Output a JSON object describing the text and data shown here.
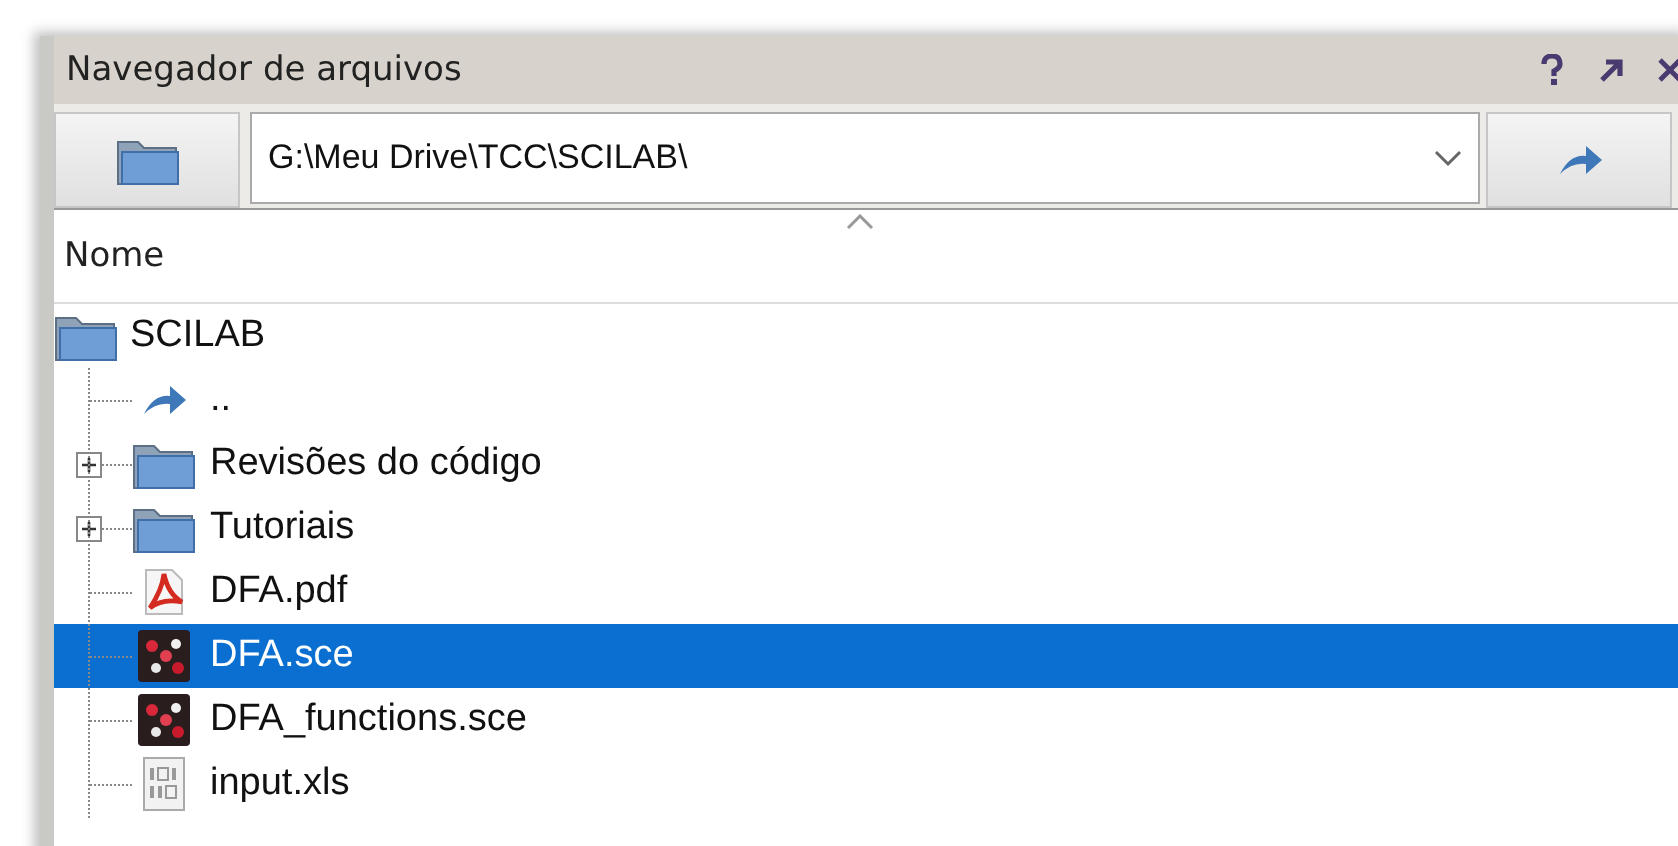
{
  "window": {
    "title": "Navegador de arquivos"
  },
  "toolbar": {
    "path": "G:\\Meu Drive\\TCC\\SCILAB\\"
  },
  "table": {
    "columns": [
      "Nome"
    ]
  },
  "tree": {
    "label": "SCILAB",
    "kind": "folder",
    "selected": false,
    "children": [
      {
        "label": "..",
        "kind": "up",
        "selected": false
      },
      {
        "label": "Revisões do código",
        "kind": "folder",
        "selected": false,
        "expanded": false
      },
      {
        "label": "Tutoriais",
        "kind": "folder",
        "selected": false,
        "expanded": false
      },
      {
        "label": "DFA.pdf",
        "kind": "pdf",
        "selected": false
      },
      {
        "label": "DFA.sce",
        "kind": "sce",
        "selected": true
      },
      {
        "label": "DFA_functions.sce",
        "kind": "sce",
        "selected": false
      },
      {
        "label": "input.xls",
        "kind": "xls",
        "selected": false
      }
    ]
  }
}
